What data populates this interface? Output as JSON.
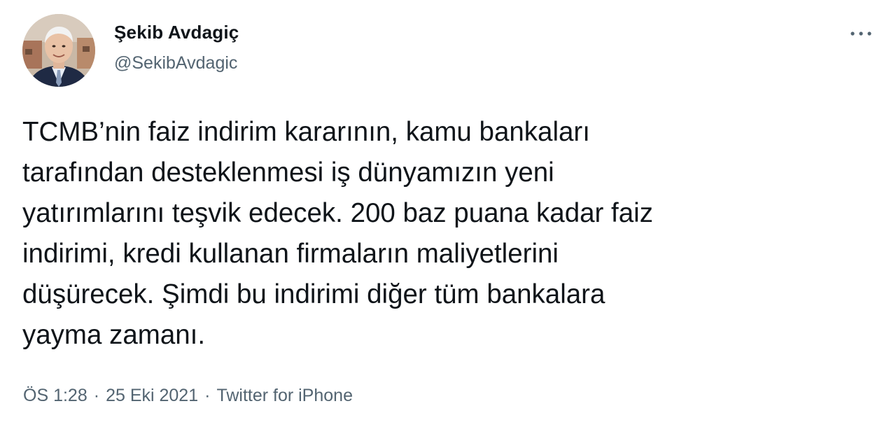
{
  "author": {
    "display_name": "Şekib Avdagiç",
    "handle": "@SekibAvdagic"
  },
  "tweet": {
    "text": "TCMB’nin faiz indirim kararının, kamu bankaları\ntarafından desteklenmesi iş dünyamızın yeni\nyatırımlarını teşvik edecek. 200 baz puana kadar faiz\nindirimi, kredi kullanan firmaların maliyetlerini\ndüşürecek. Şimdi bu indirimi diğer tüm bankalara\nyayma zamanı."
  },
  "meta": {
    "time": "ÖS 1:28",
    "separator": "·",
    "date": "25 Eki 2021",
    "source": "Twitter for iPhone"
  },
  "icons": {
    "more": "more-horizontal-icon",
    "avatar": "profile-photo"
  },
  "colors": {
    "text_primary": "#0f1419",
    "text_secondary": "#536471",
    "background": "#ffffff"
  }
}
